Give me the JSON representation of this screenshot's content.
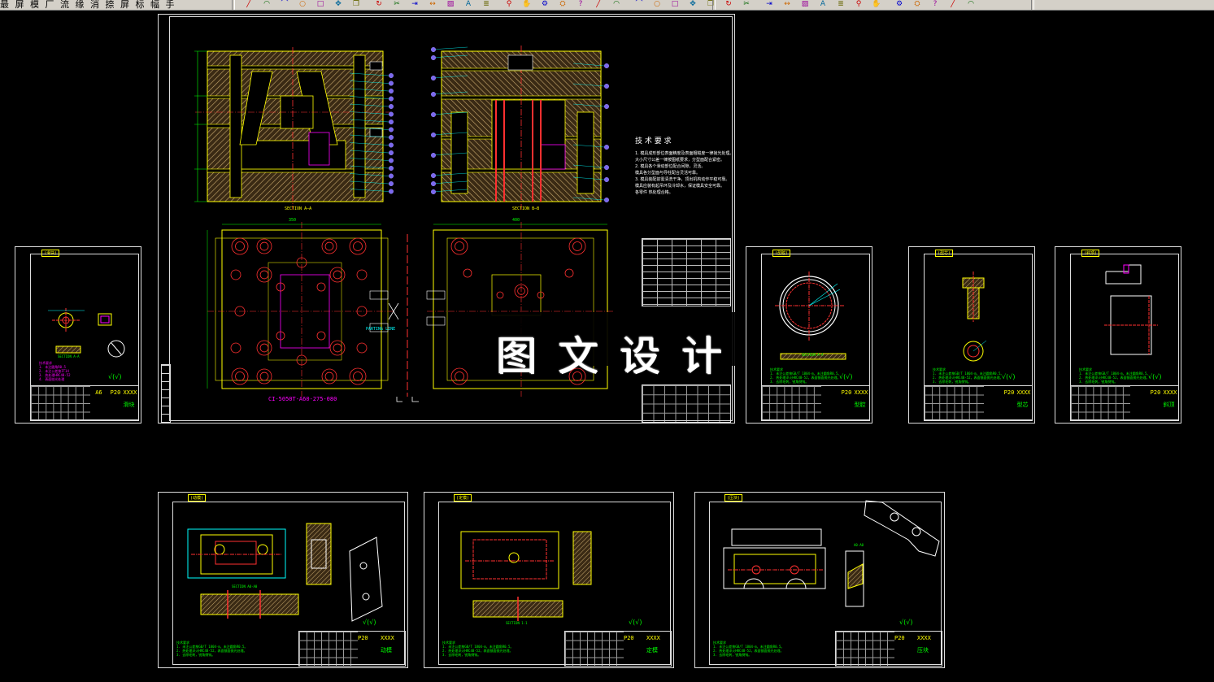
{
  "toolbar": {
    "menu_text": "最 屏 模 厂 流 缘 消 捺 屏 标 幅 手",
    "icons": [
      "line-icon",
      "arc-icon",
      "polyline-icon",
      "circle-icon",
      "rectangle-icon",
      "move-icon",
      "copy-icon",
      "rotate-icon",
      "trim-icon",
      "extend-icon",
      "dimension-icon",
      "hatch-icon",
      "text-icon",
      "layer-icon",
      "zoom-icon",
      "pan-icon",
      "properties-icon",
      "settings-icon",
      "help-icon"
    ]
  },
  "main_sheet": {
    "tech_title": "技 术 要 求",
    "tech_lines": [
      "1. 模具成形部位表面精度及表面粗糙度一律抛光处理。",
      "   大小尺寸公差一律按图纸要求，分型面配合紧密。",
      "2. 模具各个滑动部位配合间隙，灵活。",
      "   模具各分型面与导柱配合灵活可靠。",
      "3. 模具装配前需清洗干净，顶出机构动作平稳可靠。",
      "   模具应装有起吊环及冷却水，保证模具安全可靠。",
      "   各零件  热处理合格。"
    ],
    "section_label_left": "SECTION A—A",
    "section_label_right": "SECTION B—B",
    "bottom_label": "CI-5050T-A60-275-080",
    "parting_label": "PARTING LINE",
    "dim_width_top": "350",
    "dim_width_plan": "400"
  },
  "watermark": "图文设计",
  "sheets": {
    "sheet1": {
      "code": "P20",
      "name": "A6",
      "mark": "XXXX",
      "title": "滑块",
      "tag": "(滑块)",
      "section": "SECTION A-A"
    },
    "sheet2": {
      "code": "P20",
      "mark": "XXXX",
      "title": "型腔",
      "tag": "(型腔)",
      "section": "SECTION A-A"
    },
    "sheet3": {
      "code": "P20",
      "mark": "XXXX",
      "title": "型芯",
      "tag": "(型芯)"
    },
    "sheet4": {
      "code": "P20",
      "mark": "XXXX",
      "title": "斜顶",
      "tag": "(斜顶)"
    },
    "sheet5": {
      "code": "P20",
      "mark": "XXXX",
      "title": "动模",
      "tag": "(动模)",
      "section": "SECTION A0-A0"
    },
    "sheet6": {
      "code": "P20",
      "mark": "XXXX",
      "title": "定模",
      "tag": "(定模)",
      "section": "SECTION 1-1"
    },
    "sheet7": {
      "code": "P20",
      "mark": "XXXX",
      "title": "压块",
      "tag": "(压块)",
      "section": "A0-A0"
    }
  },
  "roughness": "√(√)",
  "notes": {
    "magenta": [
      "技术要求",
      "1. 未注圆角R0.5",
      "2. 未注公差按IT14",
      "3. 热处理HRC48-52",
      "4. 表面抛光处理"
    ],
    "green": [
      "技术要求",
      "1. 未注公差按GB/T 1804-m，未注圆角R0.5。",
      "2. 热处理淬火HRC48-52，表面镜面抛光处理。",
      "3. 去除毛刺，锐角倒钝。"
    ]
  },
  "colors": {
    "background": "#000000",
    "border": "#dddddd",
    "outline": "#ffff00",
    "centerline": "#ff3030",
    "dimension": "#00ffff",
    "hatch": "#c9a96e",
    "balloon": "#7b68ee"
  }
}
